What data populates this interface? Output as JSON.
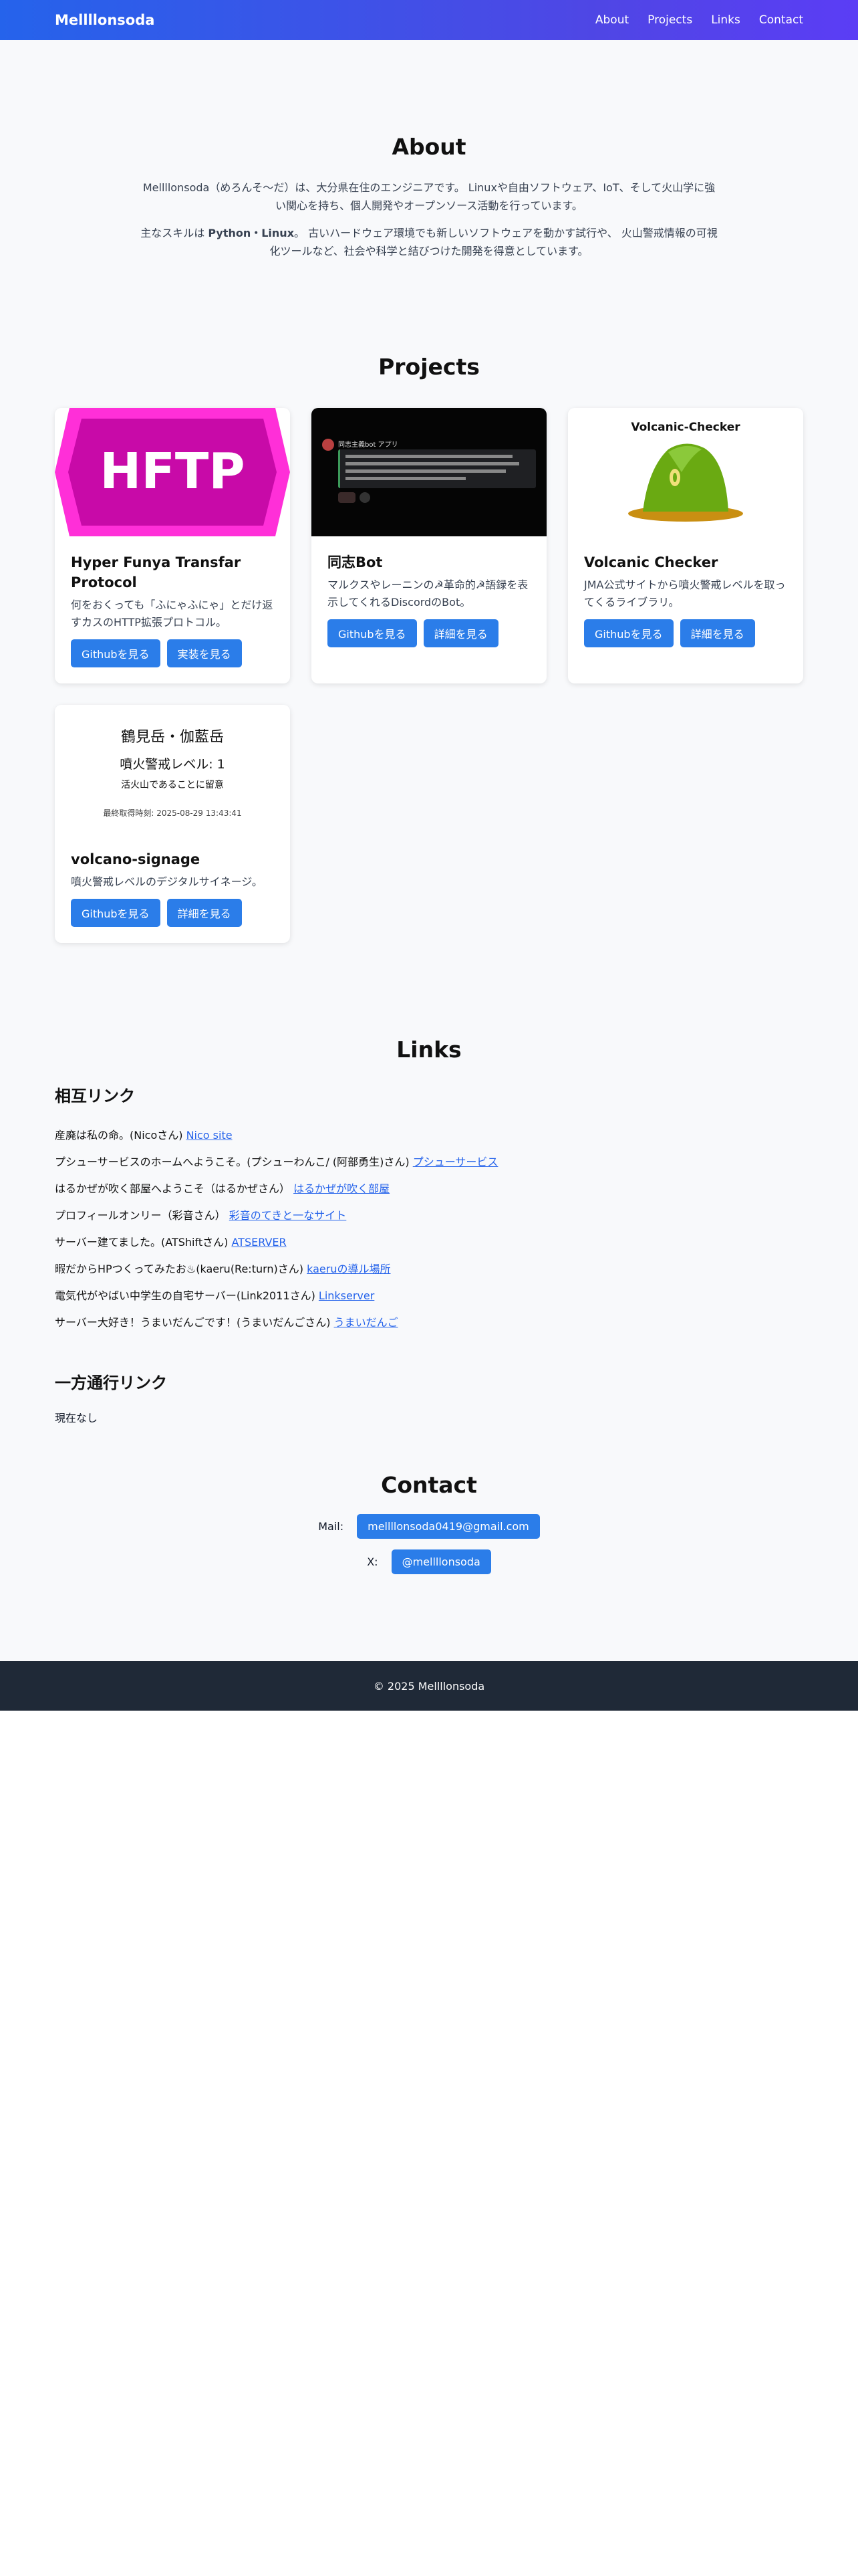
{
  "header": {
    "brand": "Mellllonsoda",
    "nav": [
      "About",
      "Projects",
      "Links",
      "Contact"
    ]
  },
  "about": {
    "title": "About",
    "p1": "Mellllonsoda（めろんそ〜だ）は、大分県在住のエンジニアです。 Linuxや自由ソフトウェア、IoT、そして火山学に強い関心を持ち、個人開発やオープンソース活動を行っています。",
    "p2_prefix": "主なスキルは ",
    "p2_skills": "Python・Linux",
    "p2_suffix": "。 古いハードウェア環境でも新しいソフトウェアを動かす試行や、 火山警戒情報の可視化ツールなど、社会や科学と結びつけた開発を得意としています。"
  },
  "projects": {
    "title": "Projects",
    "items": [
      {
        "title": "Hyper Funya Transfar Protocol",
        "desc": "何をおくっても「ふにゃふにゃ」とだけ返すカスのHTTP拡張プロトコル。",
        "btn1": "Githubを見る",
        "btn2": "実装を見る",
        "image_text": "HFTP"
      },
      {
        "title": "同志Bot",
        "desc": "マルクスやレーニンの☭革命的☭語録を表示してくれるDiscordのBot。",
        "btn1": "Githubを見る",
        "btn2": "詳細を見る",
        "image_text": "同志主義bot アプリ"
      },
      {
        "title": "Volcanic Checker",
        "desc": "JMA公式サイトから噴火警戒レベルを取ってくるライブラリ。",
        "btn1": "Githubを見る",
        "btn2": "詳細を見る",
        "image_text": "Volcanic-Checker"
      },
      {
        "title": "volcano-signage",
        "desc": "噴火警戒レベルのデジタルサイネージ。",
        "btn1": "Githubを見る",
        "btn2": "詳細を見る"
      }
    ],
    "signage": {
      "name": "鶴見岳・伽藍岳",
      "level": "噴火警戒レベル: 1",
      "note": "活火山であることに留意",
      "updated": "最終取得時刻: 2025-08-29 13:43:41"
    }
  },
  "links": {
    "title": "Links",
    "mutual_title": "相互リンク",
    "mutual": [
      {
        "text": "産廃は私の命。(Nicoさん) ",
        "link": "Nico site"
      },
      {
        "text": "プシューサービスのホームへようこそ。(プシューわんこ/ (阿部勇生)さん) ",
        "link": "プシューサービス"
      },
      {
        "text": "はるかぜが吹く部屋へようこそ（はるかぜさん） ",
        "link": "はるかぜが吹く部屋"
      },
      {
        "text": "プロフィールオンリー（彩音さん） ",
        "link": "彩音のてきと一なサイト"
      },
      {
        "text": "サーバー建てました。(ATShiftさん) ",
        "link": "ATSERVER"
      },
      {
        "text": "暇だからHPつくってみたお♨(kaeru(Re:turn)さん) ",
        "link": "kaeruの導ル場所"
      },
      {
        "text": "電気代がやばい中学生の自宅サーバー(Link2011さん) ",
        "link": "Linkserver"
      },
      {
        "text": "サーバー大好き！うまいだんごです！(うまいだんごさん) ",
        "link": "うまいだんご"
      }
    ],
    "oneway_title": "一方通行リンク",
    "oneway_text": "現在なし"
  },
  "contact": {
    "title": "Contact",
    "mail_label": "Mail:",
    "mail_value": "mellllonsoda0419@gmail.com",
    "x_label": "X:",
    "x_value": "@mellllonsoda"
  },
  "footer": {
    "text": "© 2025 Mellllonsoda"
  },
  "colors": {
    "accent": "#2b7de9",
    "header_start": "#2563eb",
    "header_end": "#5b3df5",
    "footer_bg": "#1f2937",
    "hftp_pink": "#ff2fd8"
  }
}
